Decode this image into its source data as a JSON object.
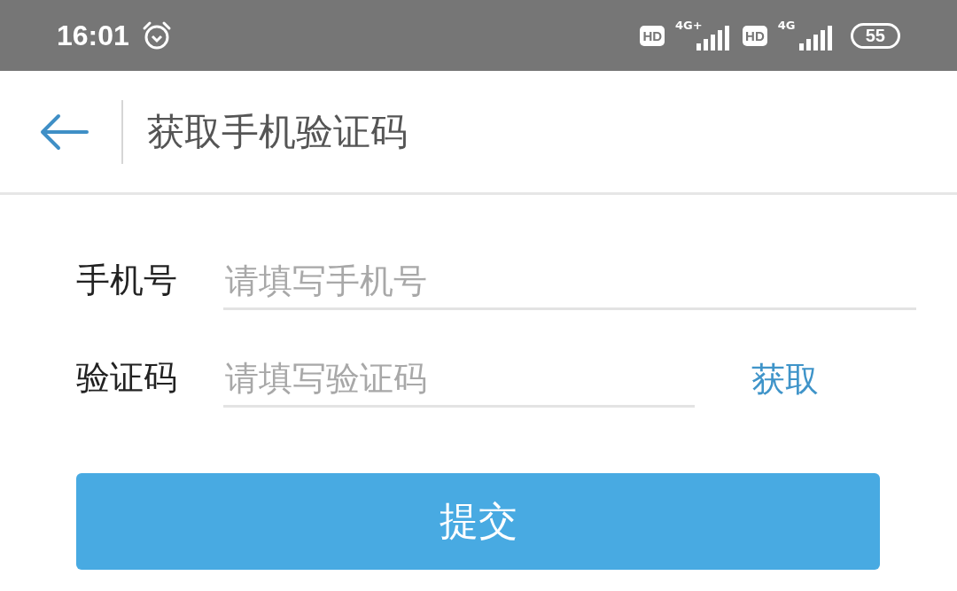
{
  "status_bar": {
    "time": "16:01",
    "sim1": {
      "hd": "HD",
      "network": "4G+"
    },
    "sim2": {
      "hd": "HD",
      "network": "4G"
    },
    "battery": "55"
  },
  "header": {
    "title": "获取手机验证码"
  },
  "form": {
    "fields": [
      {
        "label": "手机号",
        "placeholder": "请填写手机号",
        "kind": "text"
      },
      {
        "label": "验证码",
        "placeholder": "请填写验证码",
        "kind": "code",
        "action": "获取"
      }
    ]
  },
  "submit_button": "提交"
}
